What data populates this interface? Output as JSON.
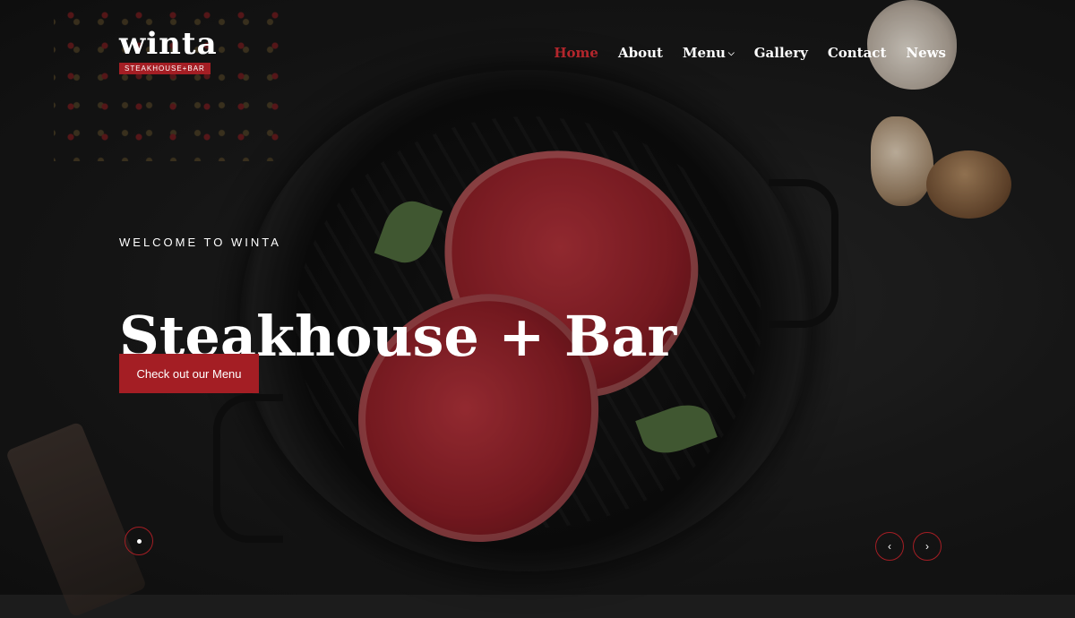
{
  "brand": {
    "name": "winta",
    "tagline": "STEAKHOUSE+BAR",
    "accent": "#a41e24"
  },
  "nav": {
    "items": [
      {
        "label": "Home",
        "active": true
      },
      {
        "label": "About",
        "active": false
      },
      {
        "label": "Menu",
        "active": false,
        "dropdown": true
      },
      {
        "label": "Gallery",
        "active": false
      },
      {
        "label": "Contact",
        "active": false
      },
      {
        "label": "News",
        "active": false
      }
    ],
    "dropdown_icon": "chevron-down-icon"
  },
  "hero": {
    "eyebrow": "WELCOME TO WINTA",
    "title": "Steakhouse + Bar",
    "cta_label": "Check out our Menu"
  },
  "slider": {
    "prev_icon": "‹",
    "next_icon": "›"
  }
}
